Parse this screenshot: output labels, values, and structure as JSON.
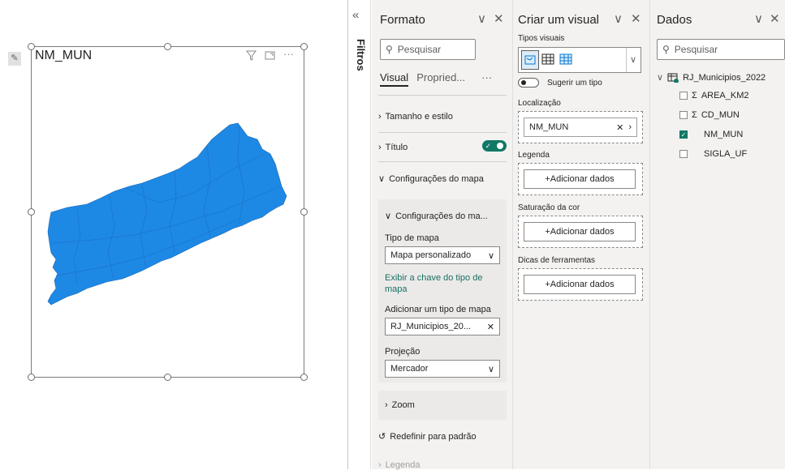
{
  "visual": {
    "title": "NM_MUN",
    "map_fill": "#1e88e5",
    "header_icons": [
      "filter-icon",
      "focus-mode-icon",
      "more-options-icon"
    ]
  },
  "filters": {
    "label": "Filtros"
  },
  "format_pane": {
    "title": "Formato",
    "search_placeholder": "Pesquisar",
    "tabs": [
      "Visual",
      "Propried...",
      "···"
    ],
    "sections": {
      "size_style": "Tamanho e estilo",
      "title": "Título",
      "map_settings": "Configurações do mapa",
      "inner_card_title": "Configurações do ma...",
      "map_type_label": "Tipo de mapa",
      "map_type_value": "Mapa personalizado",
      "show_key_link": "Exibir a chave do tipo de mapa",
      "add_map_type_label": "Adicionar um tipo de mapa",
      "add_map_type_value": "RJ_Municipios_20...",
      "projection_label": "Projeção",
      "projection_value": "Mercador",
      "zoom": "Zoom",
      "reset": "Redefinir para padrão",
      "legend": "Legenda"
    }
  },
  "build_pane": {
    "title": "Criar um visual",
    "visual_types_label": "Tipos visuais",
    "suggest_label": "Sugerir um tipo",
    "location_label": "Localização",
    "location_field": "NM_MUN",
    "legend_label": "Legenda",
    "color_saturation_label": "Saturação da cor",
    "tooltips_label": "Dicas de ferramentas",
    "add_data": "+Adicionar dados"
  },
  "data_pane": {
    "title": "Dados",
    "search_placeholder": "Pesquisar",
    "table": "RJ_Municipios_2022",
    "fields": [
      {
        "name": "AREA_KM2",
        "sigma": true,
        "checked": false
      },
      {
        "name": "CD_MUN",
        "sigma": true,
        "checked": false
      },
      {
        "name": "NM_MUN",
        "sigma": false,
        "checked": true
      },
      {
        "name": "SIGLA_UF",
        "sigma": false,
        "checked": false
      }
    ]
  },
  "accent_color": "#117865"
}
